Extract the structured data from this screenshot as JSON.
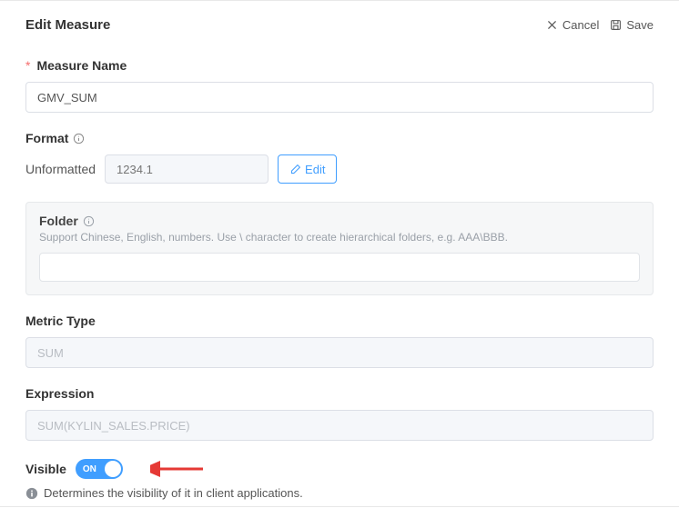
{
  "header": {
    "title": "Edit Measure",
    "cancel": "Cancel",
    "save": "Save"
  },
  "measure_name": {
    "label": "Measure Name",
    "value": "GMV_SUM"
  },
  "format": {
    "label": "Format",
    "unformatted_label": "Unformatted",
    "preview_placeholder": "1234.1",
    "edit_label": "Edit"
  },
  "folder": {
    "label": "Folder",
    "help": "Support Chinese, English, numbers. Use \\ character to create hierarchical folders, e.g. AAA\\BBB.",
    "value": ""
  },
  "metric_type": {
    "label": "Metric Type",
    "value": "SUM"
  },
  "expression": {
    "label": "Expression",
    "value": "SUM(KYLIN_SALES.PRICE)"
  },
  "visible": {
    "label": "Visible",
    "on_label": "ON",
    "help": "Determines the visibility of it in client applications."
  }
}
